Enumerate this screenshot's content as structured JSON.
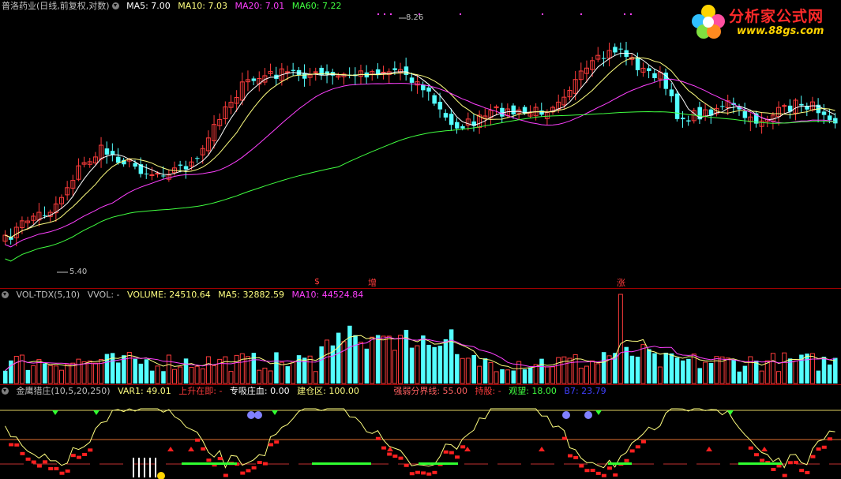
{
  "main": {
    "title": "普洛药业(日线,前复权,对数)",
    "ma5": "MA5: 7.00",
    "ma10": "MA10: 7.03",
    "ma20": "MA20: 7.01",
    "ma60": "MA60: 7.22",
    "high_label": "8.26",
    "low_label": "5.40",
    "markers": [
      "$",
      "增",
      "涨"
    ]
  },
  "volume": {
    "title": "VOL-TDX(5,10)",
    "vvol": "VVOL: -",
    "volume": "VOLUME: 24510.64",
    "ma5": "MA5: 32882.59",
    "ma10": "MA10: 44524.84"
  },
  "indicator": {
    "title": "金鹰猎庄(10,5,20,250)",
    "var1": "VAR1: 49.01",
    "rise": "上升在即: -",
    "absorb": "专吸庄血: 0.00",
    "build": "建仓区: 100.00",
    "divide": "强弱分界线: 55.00",
    "sell": "持股: -",
    "watch": "观望: 18.00",
    "b7": "B7: 23.79"
  },
  "logo": {
    "text": "分析家公式网",
    "url": "www.88gs.com"
  },
  "colors": {
    "up": "#ff3c3c",
    "down": "#54ffff",
    "ma5": "#ffffff",
    "ma10": "#ffff80",
    "ma20": "#ff40ff",
    "ma60": "#40ff40"
  }
}
